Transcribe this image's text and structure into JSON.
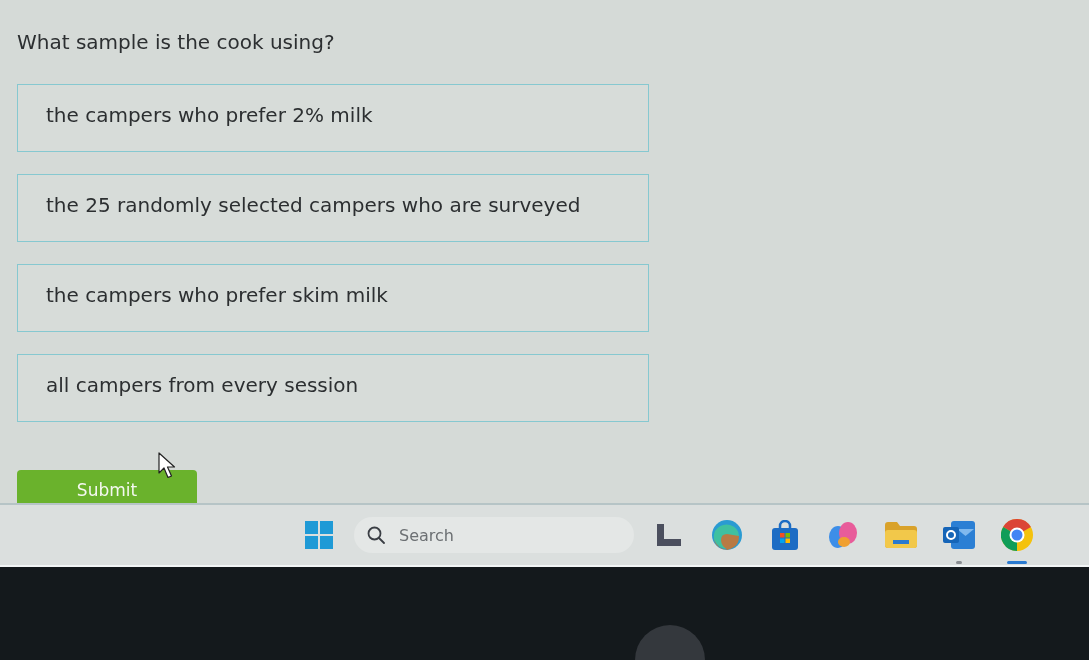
{
  "question": {
    "text": "What sample is the cook using?"
  },
  "choices": [
    {
      "text": "the campers who prefer 2% milk",
      "selected": false
    },
    {
      "text": "the 25 randomly selected campers who are surveyed",
      "selected": false
    },
    {
      "text": "the campers who prefer skim milk",
      "selected": false
    },
    {
      "text": "all campers from every session",
      "selected": false
    }
  ],
  "submit_button": {
    "label": "Submit"
  },
  "taskbar": {
    "items": [
      {
        "kind": "panes",
        "open": false,
        "active": false
      },
      {
        "kind": "search",
        "placeholder": "Search"
      },
      {
        "kind": "corner",
        "open": false,
        "active": false
      },
      {
        "kind": "swirl",
        "open": false,
        "active": false
      },
      {
        "kind": "bag",
        "open": false,
        "active": false
      },
      {
        "kind": "petals",
        "open": false,
        "active": false
      },
      {
        "kind": "folder",
        "open": false,
        "active": false
      },
      {
        "kind": "mail",
        "open": true,
        "active": false
      },
      {
        "kind": "ring",
        "open": true,
        "active": true
      }
    ]
  }
}
